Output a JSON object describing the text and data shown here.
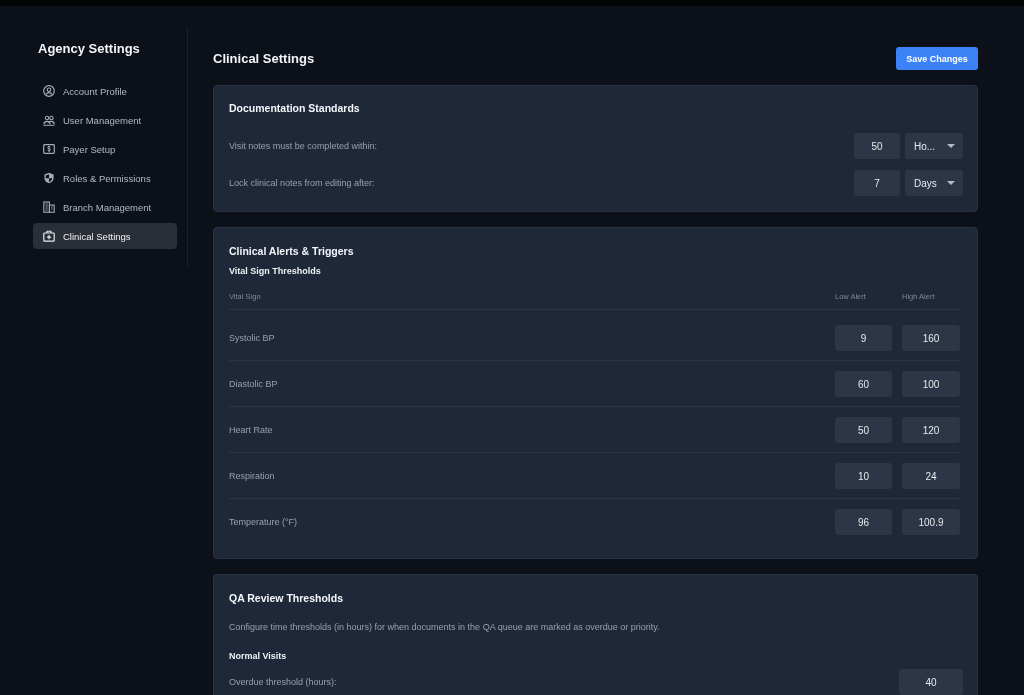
{
  "sidebar": {
    "title": "Agency Settings",
    "items": [
      {
        "label": "Account Profile",
        "selected": false
      },
      {
        "label": "User Management",
        "selected": false
      },
      {
        "label": "Payer Setup",
        "selected": false
      },
      {
        "label": "Roles & Permissions",
        "selected": false
      },
      {
        "label": "Branch Management",
        "selected": false
      },
      {
        "label": "Clinical Settings",
        "selected": true
      }
    ]
  },
  "header": {
    "title": "Clinical Settings",
    "save_button": "Save Changes"
  },
  "documentation_standards": {
    "title": "Documentation Standards",
    "rows": [
      {
        "label": "Visit notes must be completed within:",
        "value": "50",
        "unit": "Ho..."
      },
      {
        "label": "Lock clinical notes from editing after:",
        "value": "7",
        "unit": "Days"
      }
    ]
  },
  "clinical_alerts": {
    "title": "Clinical Alerts & Triggers",
    "subtitle": "Vital Sign Thresholds",
    "columns": [
      "Vital Sign",
      "Low Alert",
      "High Alert"
    ],
    "rows": [
      {
        "vital_sign": "Systolic BP",
        "low_alert": "9",
        "high_alert": "160"
      },
      {
        "vital_sign": "Diastolic BP",
        "low_alert": "60",
        "high_alert": "100"
      },
      {
        "vital_sign": "Heart Rate",
        "low_alert": "50",
        "high_alert": "120"
      },
      {
        "vital_sign": "Respiration",
        "low_alert": "10",
        "high_alert": "24"
      },
      {
        "vital_sign": "Temperature (°F)",
        "low_alert": "96",
        "high_alert": "100.9"
      }
    ]
  },
  "qa_review": {
    "title": "QA Review Thresholds",
    "description": "Configure time thresholds (in hours) for when documents in the QA queue are marked as overdue or priority.",
    "groups": [
      {
        "title": "Normal Visits",
        "rows": [
          {
            "label": "Overdue threshold (hours):",
            "value": "40"
          }
        ]
      }
    ]
  }
}
